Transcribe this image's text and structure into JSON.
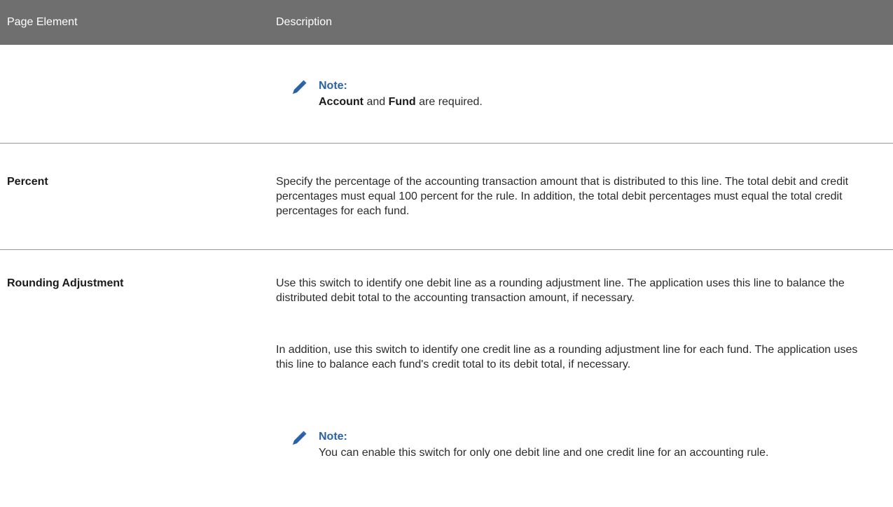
{
  "table": {
    "headers": {
      "col1": "Page Element",
      "col2": "Description"
    }
  },
  "note1": {
    "title": "Note:",
    "term1": "Account",
    "joiner": " and ",
    "term2": "Fund",
    "tail": " are required."
  },
  "rows": [
    {
      "element": "Percent",
      "description": "Specify the percentage of the accounting transaction amount that is distributed to this line. The total debit and credit percentages must equal 100 percent for the rule. In addition, the total debit percentages must equal the total credit percentages for each fund."
    },
    {
      "element": "Rounding Adjustment",
      "description_p1": "Use this switch to identify one debit line as a rounding adjustment line. The application uses this line to balance the distributed debit total to the accounting transaction amount, if necessary.",
      "description_p2": "In addition, use this switch to identify one credit line as a rounding adjustment line for each fund. The application uses this line to balance each fund's credit total to its debit total, if necessary."
    }
  ],
  "note2": {
    "title": "Note:",
    "body": "You can enable this switch for only one debit line and one credit line for an accounting rule."
  },
  "colors": {
    "header_bg": "#6f6f6f",
    "note_title": "#2a62a7",
    "pencil": "#2a62a7"
  },
  "icons": {
    "note": "pencil-icon"
  }
}
